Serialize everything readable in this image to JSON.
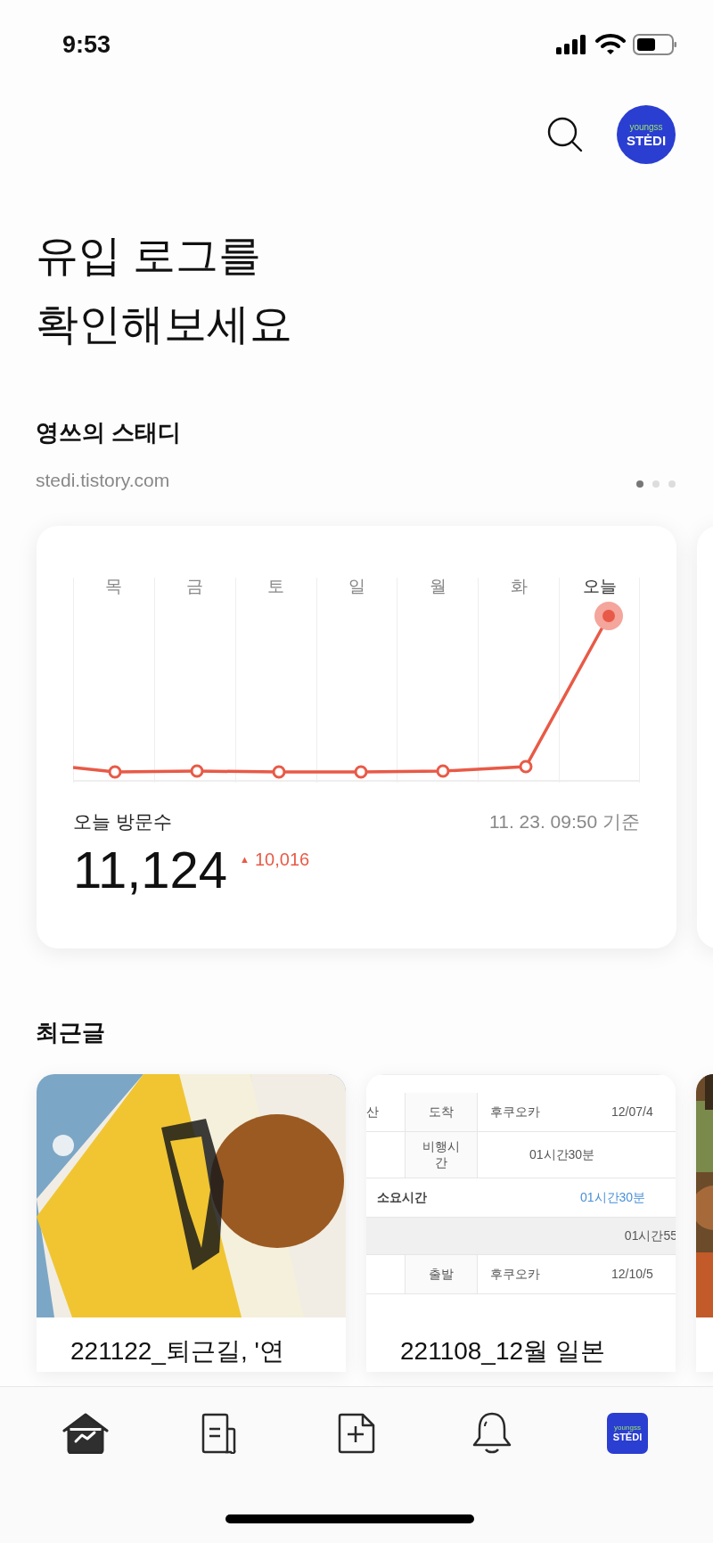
{
  "status_bar": {
    "time": "9:53"
  },
  "header": {
    "avatar": {
      "line1": "youngss",
      "line2": "STĖDI"
    }
  },
  "headline": [
    "유입 로그를",
    "확인해보세요"
  ],
  "blog": {
    "name": "영쓰의 스태디",
    "url": "stedi.tistory.com",
    "pages": [
      {
        "selected": true
      },
      {
        "selected": false
      },
      {
        "selected": false
      }
    ]
  },
  "stats_card": {
    "days": [
      {
        "label": "목",
        "selected": false
      },
      {
        "label": "금",
        "selected": false
      },
      {
        "label": "토",
        "selected": false
      },
      {
        "label": "일",
        "selected": false
      },
      {
        "label": "월",
        "selected": false
      },
      {
        "label": "화",
        "selected": false
      },
      {
        "label": "오늘",
        "selected": true
      }
    ],
    "visits_label": "오늘 방문수",
    "as_of": "11. 23. 09:50 기준",
    "visits": "11,124",
    "change_icon": "▲",
    "change": "10,016"
  },
  "recent": {
    "title": "최근글",
    "posts": [
      {
        "kind": "picture",
        "title": "221122_퇴근길, '연"
      },
      {
        "kind": "table",
        "title": "221108_12월 일본",
        "rows": [
          {
            "kind": "leg",
            "side": "산",
            "field": "도착",
            "place": "후쿠오카",
            "time": "12/07/4"
          },
          {
            "kind": "duration",
            "field": "비행시간",
            "value": "01시간30분"
          },
          {
            "kind": "total",
            "label": "소요시간",
            "value": "01시간30분"
          },
          {
            "kind": "band",
            "value": "01시간55"
          },
          {
            "kind": "leg",
            "field": "출발",
            "place": "후쿠오카",
            "time": "12/10/5"
          }
        ]
      },
      {
        "kind": "picture"
      }
    ]
  },
  "tab_bar": {
    "items": [
      {
        "kind": "home",
        "selected": true
      },
      {
        "kind": "posts",
        "selected": false
      },
      {
        "kind": "new",
        "selected": false
      },
      {
        "kind": "bell",
        "selected": false
      },
      {
        "kind": "avatar",
        "selected": false,
        "line1": "youngss",
        "line2": "STĖDI"
      }
    ]
  }
}
